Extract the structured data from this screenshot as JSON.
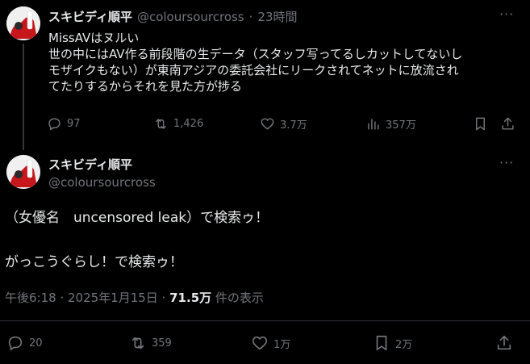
{
  "reply_tweet": {
    "name": "スキビディ順平",
    "handle": "@coloursourcross",
    "time": "23時間",
    "separator": "·",
    "more_label": "···",
    "lines": [
      "MissAVはヌルい",
      "世の中にはAV作る前段階の生データ（スタッフ写ってるしカットしてないし",
      "モザイクもない）が東南アジアの委託会社にリークされてネットに放流され",
      "てたりするからそれを見た方が捗る"
    ],
    "actions": {
      "replies": "97",
      "retweets": "1,426",
      "likes": "3.7万",
      "views": "357万"
    }
  },
  "main_tweet": {
    "name": "スキビディ順平",
    "handle": "@coloursourcross",
    "more_label": "···",
    "line1": "（女優名　uncensored leak）で検索ゥ！",
    "line2": "がっこうぐらし！で検索ゥ！",
    "timestamp": "午後6:18 · 2025年1月15日 ·",
    "views_count": "71.5万",
    "views_label": "件の表示",
    "actions": {
      "replies": "20",
      "retweets": "359",
      "likes": "1万",
      "bookmarks": "2万"
    }
  },
  "colors": {
    "background": "#000000",
    "text": "#e7e9ea",
    "muted": "#71767b",
    "divider": "#2f3336"
  }
}
